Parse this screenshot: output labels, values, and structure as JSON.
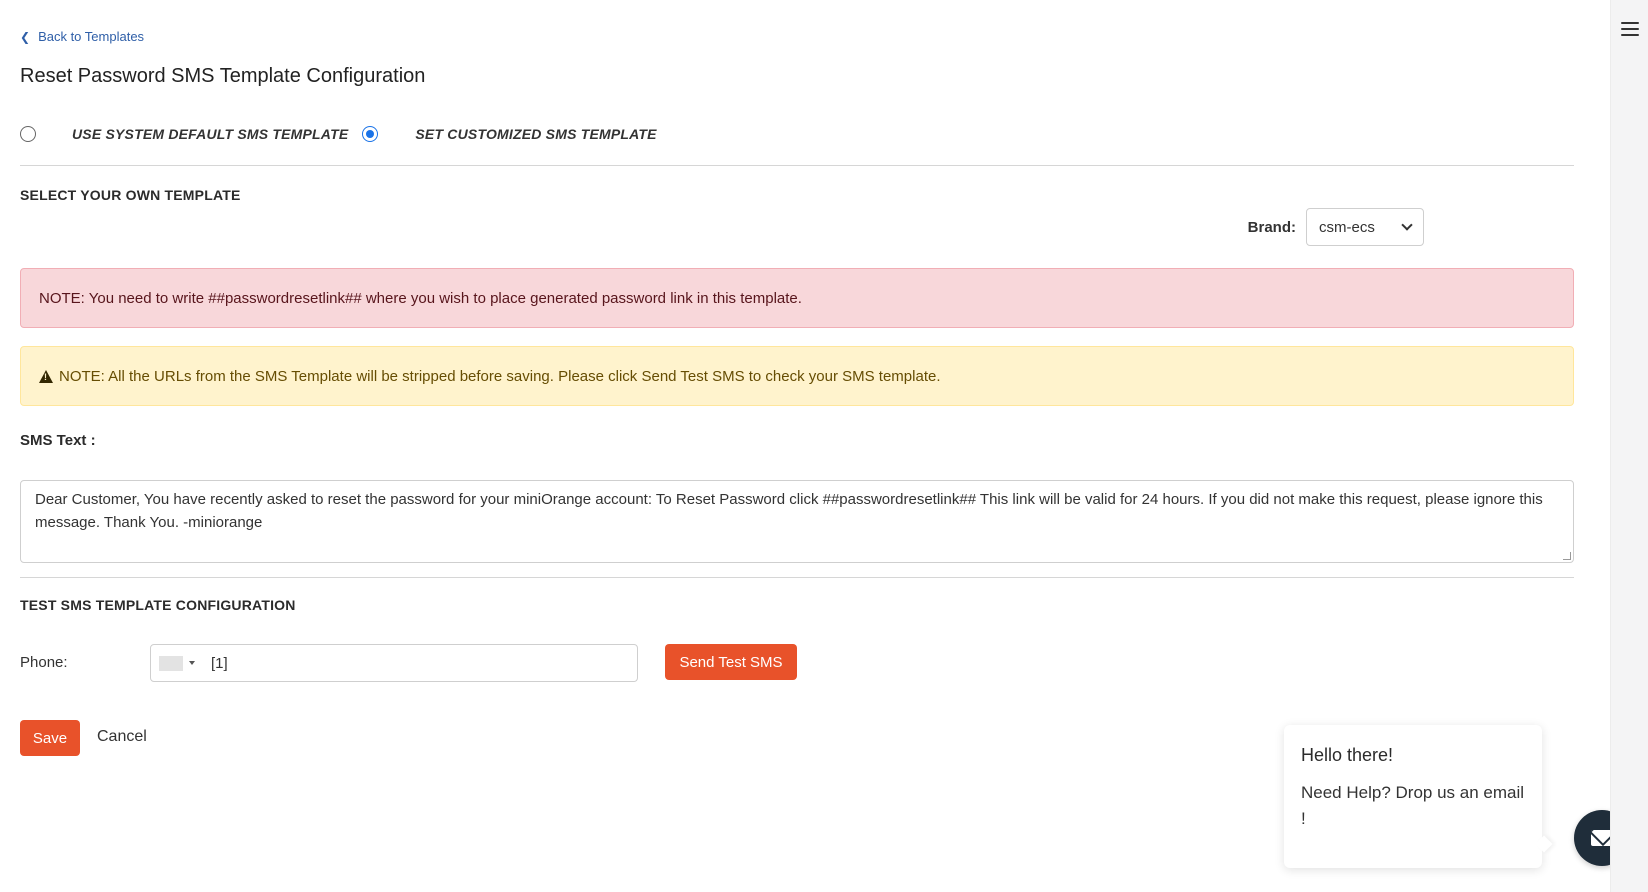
{
  "nav": {
    "back_label": "Back to Templates"
  },
  "page": {
    "title": "Reset Password SMS Template Configuration"
  },
  "template_mode": {
    "options": [
      {
        "label": "USE SYSTEM DEFAULT SMS TEMPLATE",
        "selected": false
      },
      {
        "label": "SET CUSTOMIZED SMS TEMPLATE",
        "selected": true
      }
    ]
  },
  "select_section": {
    "heading": "SELECT YOUR OWN TEMPLATE",
    "brand_label": "Brand:",
    "brand_value": "csm-ecs"
  },
  "alerts": {
    "danger": "NOTE: You need to write ##passwordresetlink## where you wish to place generated password link in this template.",
    "warning": "NOTE: All the URLs from the SMS Template will be stripped before saving. Please click Send Test SMS to check your SMS template."
  },
  "sms": {
    "label": "SMS Text :",
    "text": "Dear Customer, You have recently asked to reset the password for your miniOrange account: To Reset Password click ##passwordresetlink## This link will be valid for 24 hours. If you did not make this request, please ignore this message. Thank You. -miniorange"
  },
  "test_section": {
    "heading": "TEST SMS TEMPLATE CONFIGURATION",
    "phone_label": "Phone:",
    "phone_value": "[1]",
    "send_label": "Send Test SMS"
  },
  "actions": {
    "save_label": "Save",
    "cancel_label": "Cancel"
  },
  "help": {
    "title": "Hello there!",
    "text": "Need Help? Drop us an email !"
  },
  "colors": {
    "accent": "#e8522a",
    "radio_selected": "#1a73e8",
    "link": "#2f5fa8",
    "chat_button": "#1f2d3a"
  },
  "icons": {
    "back": "chevron-left-icon",
    "menu": "hamburger-menu-icon",
    "warning": "warning-triangle-icon",
    "dropdown": "chevron-down-icon",
    "chat": "mail-icon"
  }
}
